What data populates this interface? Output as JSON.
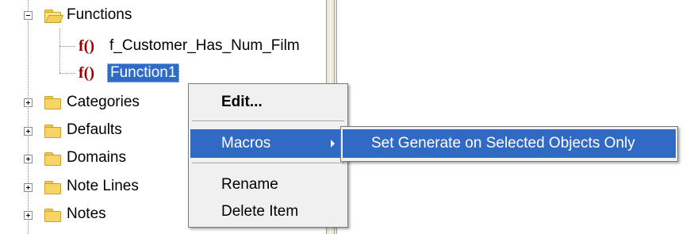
{
  "tree": {
    "nodes": [
      {
        "label": "Functions",
        "expander": "minus",
        "icon": "folder-open"
      },
      {
        "label": "f_Customer_Has_Num_Film",
        "icon": "function",
        "icon_text": "f()"
      },
      {
        "label": "Function1",
        "icon": "function",
        "icon_text": "f()",
        "selected": true
      },
      {
        "label": "Categories",
        "expander": "plus",
        "icon": "folder"
      },
      {
        "label": "Defaults",
        "expander": "plus",
        "icon": "folder"
      },
      {
        "label": "Domains",
        "expander": "plus",
        "icon": "folder"
      },
      {
        "label": "Note Lines",
        "expander": "plus",
        "icon": "folder"
      },
      {
        "label": "Notes",
        "expander": "plus",
        "icon": "folder"
      }
    ]
  },
  "context_menu": {
    "items": [
      {
        "label": "Edit..."
      },
      {
        "label": "Macros",
        "highlighted": true,
        "has_submenu": true
      },
      {
        "label": "Rename"
      },
      {
        "label": "Delete Item"
      }
    ]
  },
  "submenu": {
    "items": [
      {
        "label": "Set Generate on Selected Objects Only",
        "highlighted": true
      }
    ]
  },
  "colors": {
    "selection": "#316ac5",
    "function_icon": "#990000",
    "folder": "#f6d465"
  }
}
